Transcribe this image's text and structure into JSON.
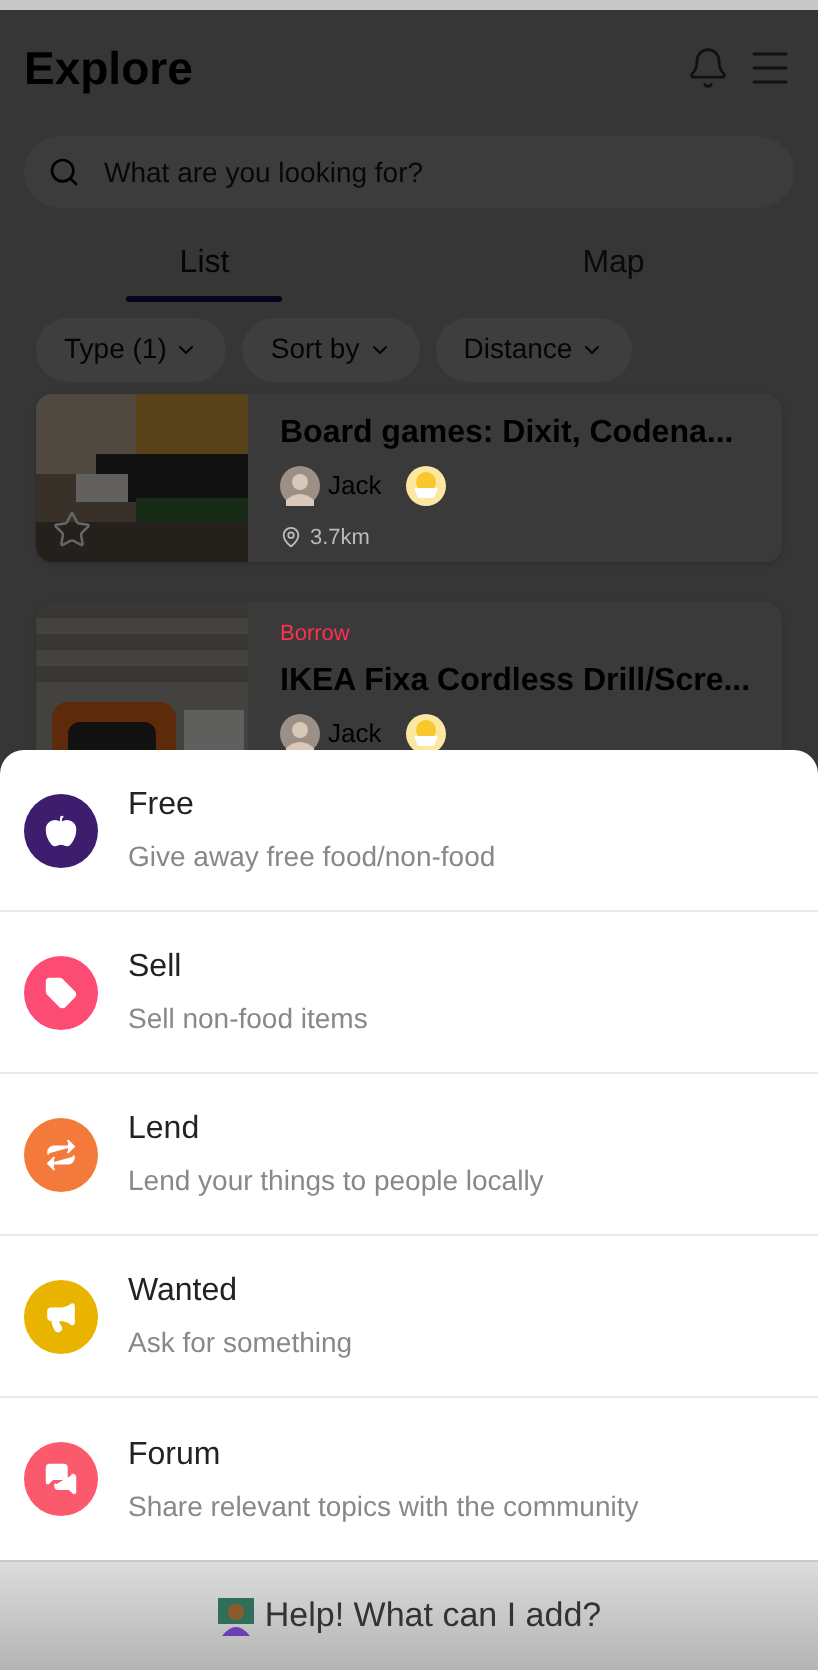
{
  "header": {
    "title": "Explore"
  },
  "search": {
    "placeholder": "What are you looking for?"
  },
  "tabs": [
    {
      "label": "List",
      "selected": true
    },
    {
      "label": "Map",
      "selected": false
    }
  ],
  "filters": [
    "Type (1)",
    "Sort by",
    "Distance"
  ],
  "listings": [
    {
      "title": "Board games: Dixit, Codena...",
      "user": "Jack",
      "distance": "3.7km",
      "starred": false
    },
    {
      "tag": "Borrow",
      "title": "IKEA Fixa Cordless Drill/Scre...",
      "user": "Jack"
    }
  ],
  "add_menu": [
    {
      "kind": "free",
      "title": "Free",
      "subtitle": "Give away free food/non-food",
      "color": "#3f1d6e"
    },
    {
      "kind": "sell",
      "title": "Sell",
      "subtitle": "Sell non-food items",
      "color": "#fd4c74"
    },
    {
      "kind": "lend",
      "title": "Lend",
      "subtitle": "Lend your things to people locally",
      "color": "#f47a3b"
    },
    {
      "kind": "wanted",
      "title": "Wanted",
      "subtitle": "Ask for something",
      "color": "#e9b400"
    },
    {
      "kind": "forum",
      "title": "Forum",
      "subtitle": "Share relevant topics with the community",
      "color": "#fb5a6c"
    }
  ],
  "help_button": "Help! What can I add?"
}
